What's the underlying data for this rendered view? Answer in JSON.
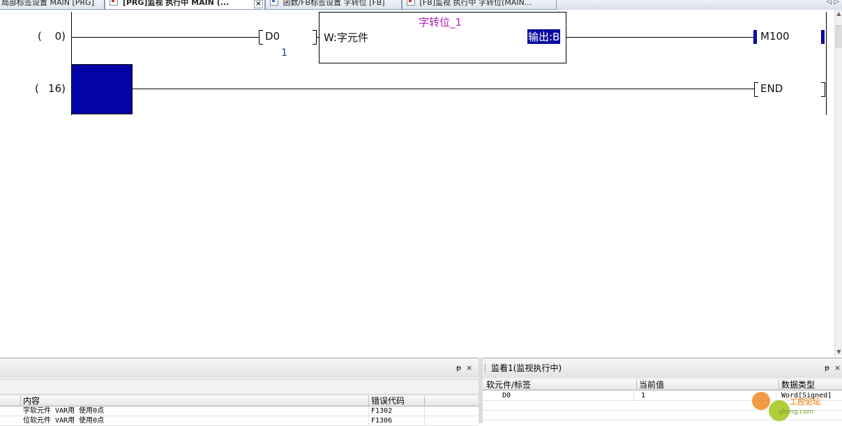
{
  "tabs": [
    {
      "label": "局部标签设置 MAIN [PRG]",
      "active": false
    },
    {
      "label": "[PRG]监视 执行中 MAIN (...",
      "active": true
    },
    {
      "label": "函数/FB标签设置 字转位 [FB]",
      "active": false
    },
    {
      "label": "[FB]监视 执行中 字转位(MAIN...",
      "active": false
    }
  ],
  "tab_close": "×",
  "tab_nav": "◁ ▷",
  "ladder": {
    "rung0": {
      "step_open": "(",
      "step_num": "0)",
      "device": "D0",
      "monitor_value": "1",
      "fb_instance": "字转位_1",
      "fb_input": "W:字元件",
      "fb_output": "输出:B",
      "coil": "M100"
    },
    "rung1": {
      "step_open": "(",
      "step_num": "16)",
      "end": "END"
    }
  },
  "error_panel": {
    "pin": "ᵽ",
    "close": "×",
    "columns": [
      "内容",
      "错误代码"
    ],
    "rows": [
      {
        "content": "字软元件 VAR用 使用0点",
        "code": "F1302"
      },
      {
        "content": "位软元件 VAR用 使用0点",
        "code": "F1306"
      }
    ]
  },
  "watch_panel": {
    "title": "监看1(监视执行中)",
    "pin": "ᵽ",
    "close": "×",
    "columns": [
      "软元件/标签",
      "当前值",
      "数据类型"
    ],
    "rows": [
      {
        "device": "D0",
        "value": "1",
        "type": "Word[Signed]"
      }
    ]
  },
  "watermark": {
    "text": "工控论坛",
    "url": "gkong.com"
  },
  "colors": {
    "monitor_on": "#0a0aa0",
    "fb_name": "#b020c0",
    "monitor_value": "#1a3aa8"
  }
}
